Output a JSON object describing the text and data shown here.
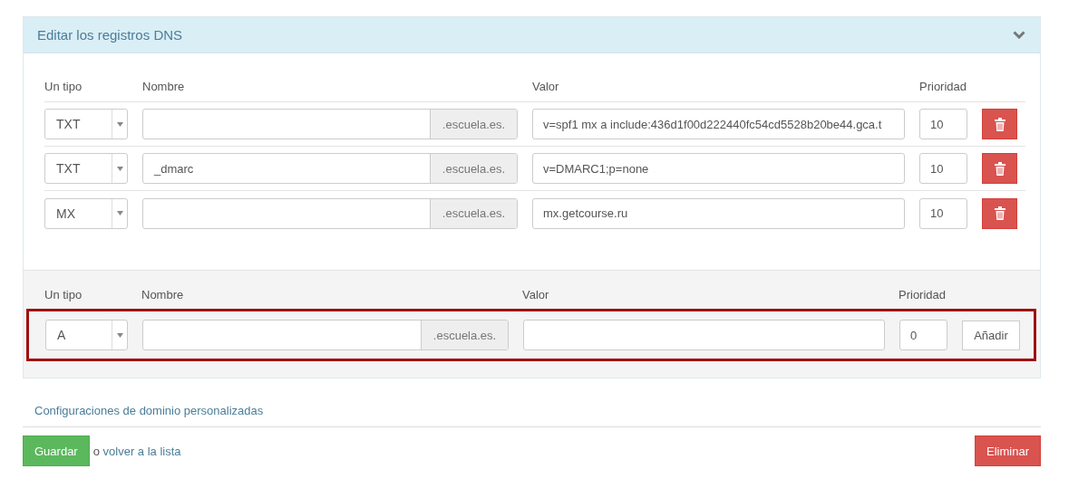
{
  "panel": {
    "title": "Editar los registros DNS",
    "expanded": true
  },
  "columns": [
    "Un tipo",
    "Nombre",
    "Valor",
    "Prioridad"
  ],
  "records": [
    {
      "type": "TXT",
      "suffix": ".escuela.es.",
      "value": "v=spf1 mx a include:436d1f00d222440fc54cd5528b20be44.gca.t",
      "priority": "10"
    },
    {
      "type": "TXT",
      "name": "_dmarc",
      "suffix": ".escuela.es.",
      "value": "v=DMARC1;p=none",
      "priority": "10"
    },
    {
      "type": "MX",
      "suffix": ".escuela.es.",
      "value": "mx.getcourse.ru",
      "priority": "10"
    }
  ],
  "new_record": {
    "columns": [
      "Un tipo",
      "Nombre",
      "Valor",
      "Prioridad"
    ],
    "type": "A",
    "suffix": ".escuela.es.",
    "priority": "0",
    "add_button": "Añadir",
    "highlighted": true
  },
  "custom_settings_link": "Configuraciones de dominio personalizadas",
  "save_button": "Guardar",
  "back_text": "o ",
  "back_link": "volver a la lista",
  "delete_button": "Eliminar"
}
